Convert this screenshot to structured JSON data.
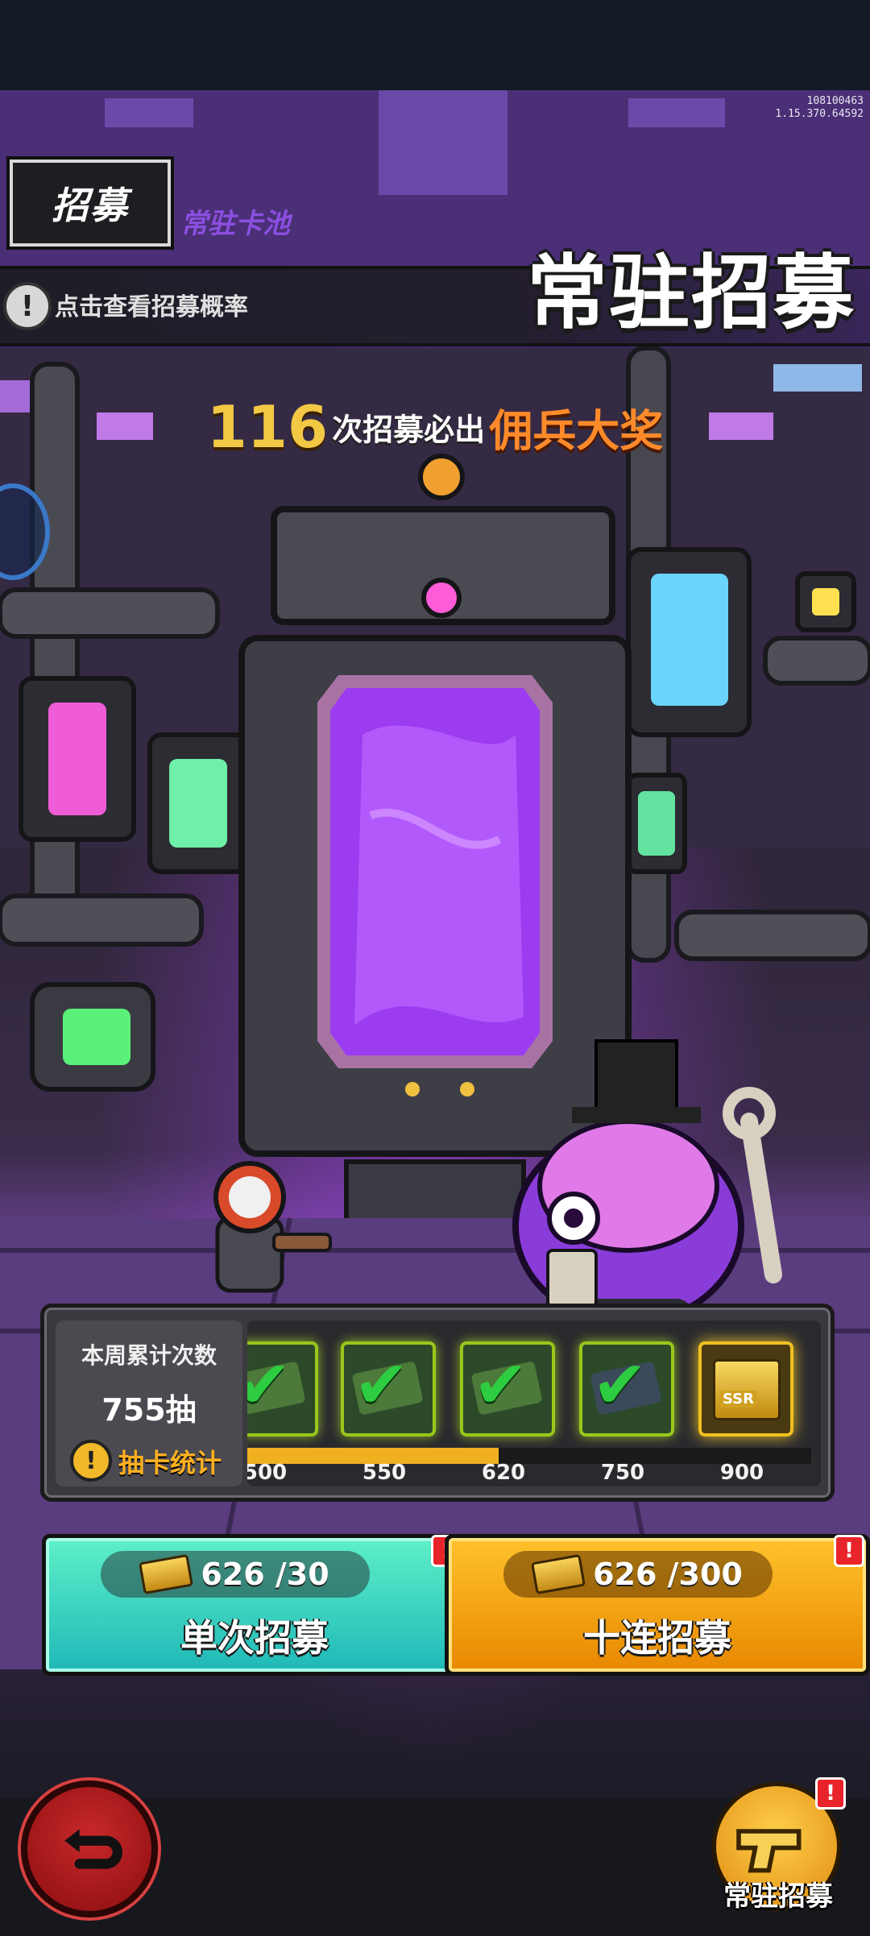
{
  "build": {
    "id": "108100463",
    "version": "1.15.370.64592"
  },
  "header": {
    "tab_title": "招募",
    "pool_name": "常驻卡池",
    "info_text": "点击查看招募概率",
    "banner_title": "常驻招募"
  },
  "pity": {
    "count": "116",
    "middle_text": "次招募必出",
    "prize": "佣兵大奖"
  },
  "weekly": {
    "label": "本周累计次数",
    "count": "755抽",
    "stats_label": "抽卡统计",
    "milestones": [
      {
        "value": "500",
        "state": "claimed"
      },
      {
        "value": "550",
        "state": "claimed"
      },
      {
        "value": "620",
        "state": "claimed"
      },
      {
        "value": "750",
        "state": "claimed"
      },
      {
        "value": "900",
        "state": "locked",
        "badge": "SSR"
      }
    ],
    "progress_fraction": 0.445
  },
  "buttons": {
    "single": {
      "cost": "626 /30",
      "label": "单次招募",
      "badge": "!"
    },
    "ten": {
      "cost": "626 /300",
      "label": "十连招募",
      "badge": "!"
    }
  },
  "bottom": {
    "side_label": "常驻招募",
    "side_badge": "!"
  },
  "colors": {
    "accent_gold": "#f2c844",
    "prize_orange": "#ff8a2a",
    "portal_purple": "#b04bff"
  }
}
